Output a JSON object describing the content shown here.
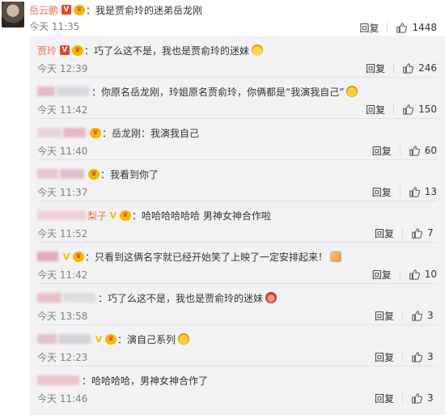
{
  "top_comment": {
    "username": "岳云鹏",
    "vip_badge": "V",
    "colon": "：",
    "text": "我是贾俞玲的迷弟岳龙刚",
    "time": "今天 11:35",
    "reply_label": "回复",
    "likes": "1448"
  },
  "replies": [
    {
      "username": "贾玲",
      "badges": [
        "vip-badge",
        "medal-badge"
      ],
      "text": "巧了么这不是，我也是贾俞玲的迷妹",
      "emoji": "smile-emoji",
      "time": "今天 12:39",
      "likes": "246"
    },
    {
      "username": "",
      "badges": [],
      "text": "你原名岳龙刚，玲姐原名贾俞玲，你俩都是“我演我自己”",
      "emoji": "laugh-emoji",
      "time": "今天 11:42",
      "likes": "150"
    },
    {
      "username": "",
      "badges": [
        "medal-badge"
      ],
      "text": "岳龙刚：我演我自己",
      "emoji": "",
      "time": "今天 11:40",
      "likes": "60"
    },
    {
      "username": "",
      "badges": [
        "medal-badge"
      ],
      "text": "我看到你了",
      "emoji": "",
      "time": "今天 11:37",
      "likes": "13"
    },
    {
      "username": "梨子",
      "badges": [
        "vip-badge",
        "medal-badge"
      ],
      "text": "哈哈哈哈哈哈 男神女神合作啦",
      "emoji": "",
      "time": "今天 11:52",
      "likes": "7"
    },
    {
      "username": "",
      "badges": [
        "vip-badge",
        "medal-badge"
      ],
      "text": "只看到这俩名字就已经开始笑了上映了一定安排起来！",
      "emoji": "muscle-emoji",
      "time": "今天 11:42",
      "likes": "10"
    },
    {
      "username": "",
      "badges": [],
      "text": "巧了么这不是，我也是贾俞玲的迷妹",
      "emoji": "cover-face-emoji",
      "time": "今天 13:58",
      "likes": "3"
    },
    {
      "username": "",
      "badges": [
        "vip-badge",
        "medal-badge"
      ],
      "text": "演自己系列",
      "emoji": "laugh-emoji",
      "time": "今天 12:23",
      "likes": "3"
    },
    {
      "username": "",
      "badges": [],
      "text": "哈哈哈哈，男神女神合作了",
      "emoji": "",
      "time": "今天 11:46",
      "likes": "3"
    }
  ],
  "common": {
    "colon": "：",
    "reply_label": "回复",
    "vip_badge": "V",
    "medal_glyph": "♛"
  },
  "colors": {
    "username": "#eb7350",
    "panel_bg": "#f2f2f5",
    "text": "#333333",
    "meta": "#808080"
  }
}
